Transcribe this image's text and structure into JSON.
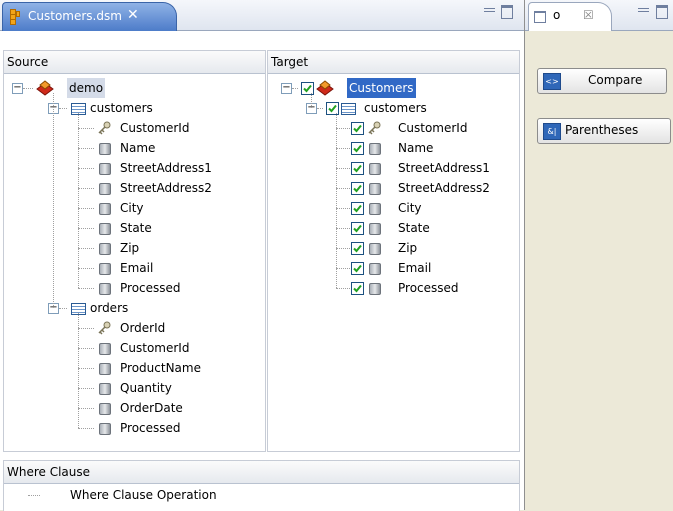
{
  "editor": {
    "tab_title": "Customers.dsm",
    "close_glyph": "✕",
    "icon": "db-schema-icon"
  },
  "source": {
    "header": "Source",
    "root": {
      "label": "demo",
      "icon": "database-icon"
    },
    "tables": [
      {
        "label": "customers",
        "icon": "table-icon",
        "columns": [
          {
            "label": "CustomerId",
            "icon": "key-icon"
          },
          {
            "label": "Name",
            "icon": "column-icon"
          },
          {
            "label": "StreetAddress1",
            "icon": "column-icon"
          },
          {
            "label": "StreetAddress2",
            "icon": "column-icon"
          },
          {
            "label": "City",
            "icon": "column-icon"
          },
          {
            "label": "State",
            "icon": "column-icon"
          },
          {
            "label": "Zip",
            "icon": "column-icon"
          },
          {
            "label": "Email",
            "icon": "column-icon"
          },
          {
            "label": "Processed",
            "icon": "column-icon"
          }
        ]
      },
      {
        "label": "orders",
        "icon": "table-icon",
        "columns": [
          {
            "label": "OrderId",
            "icon": "key-icon"
          },
          {
            "label": "CustomerId",
            "icon": "column-icon"
          },
          {
            "label": "ProductName",
            "icon": "column-icon"
          },
          {
            "label": "Quantity",
            "icon": "column-icon"
          },
          {
            "label": "OrderDate",
            "icon": "column-icon"
          },
          {
            "label": "Processed",
            "icon": "column-icon"
          }
        ]
      }
    ]
  },
  "target": {
    "header": "Target",
    "root": {
      "label": "Customers",
      "icon": "database-icon",
      "checked": true
    },
    "table": {
      "label": "customers",
      "icon": "table-icon",
      "checked": true
    },
    "columns": [
      {
        "label": "CustomerId",
        "icon": "key-icon",
        "checked": true
      },
      {
        "label": "Name",
        "icon": "column-icon",
        "checked": true
      },
      {
        "label": "StreetAddress1",
        "icon": "column-icon",
        "checked": true
      },
      {
        "label": "StreetAddress2",
        "icon": "column-icon",
        "checked": true
      },
      {
        "label": "City",
        "icon": "column-icon",
        "checked": true
      },
      {
        "label": "State",
        "icon": "column-icon",
        "checked": true
      },
      {
        "label": "Zip",
        "icon": "column-icon",
        "checked": true
      },
      {
        "label": "Email",
        "icon": "column-icon",
        "checked": true
      },
      {
        "label": "Processed",
        "icon": "column-icon",
        "checked": true
      }
    ]
  },
  "where": {
    "header": "Where Clause",
    "operation": "Where Clause Operation"
  },
  "side": {
    "tab_glyph": "o",
    "close_glyph": "☒",
    "compare_label": "Compare",
    "parentheses_label": "Parentheses",
    "parentheses_icon_text": "&|"
  },
  "colors": {
    "tab_active": "#4d7cc9",
    "selection": "#3169c6",
    "checkbox_check": "#21a121"
  }
}
